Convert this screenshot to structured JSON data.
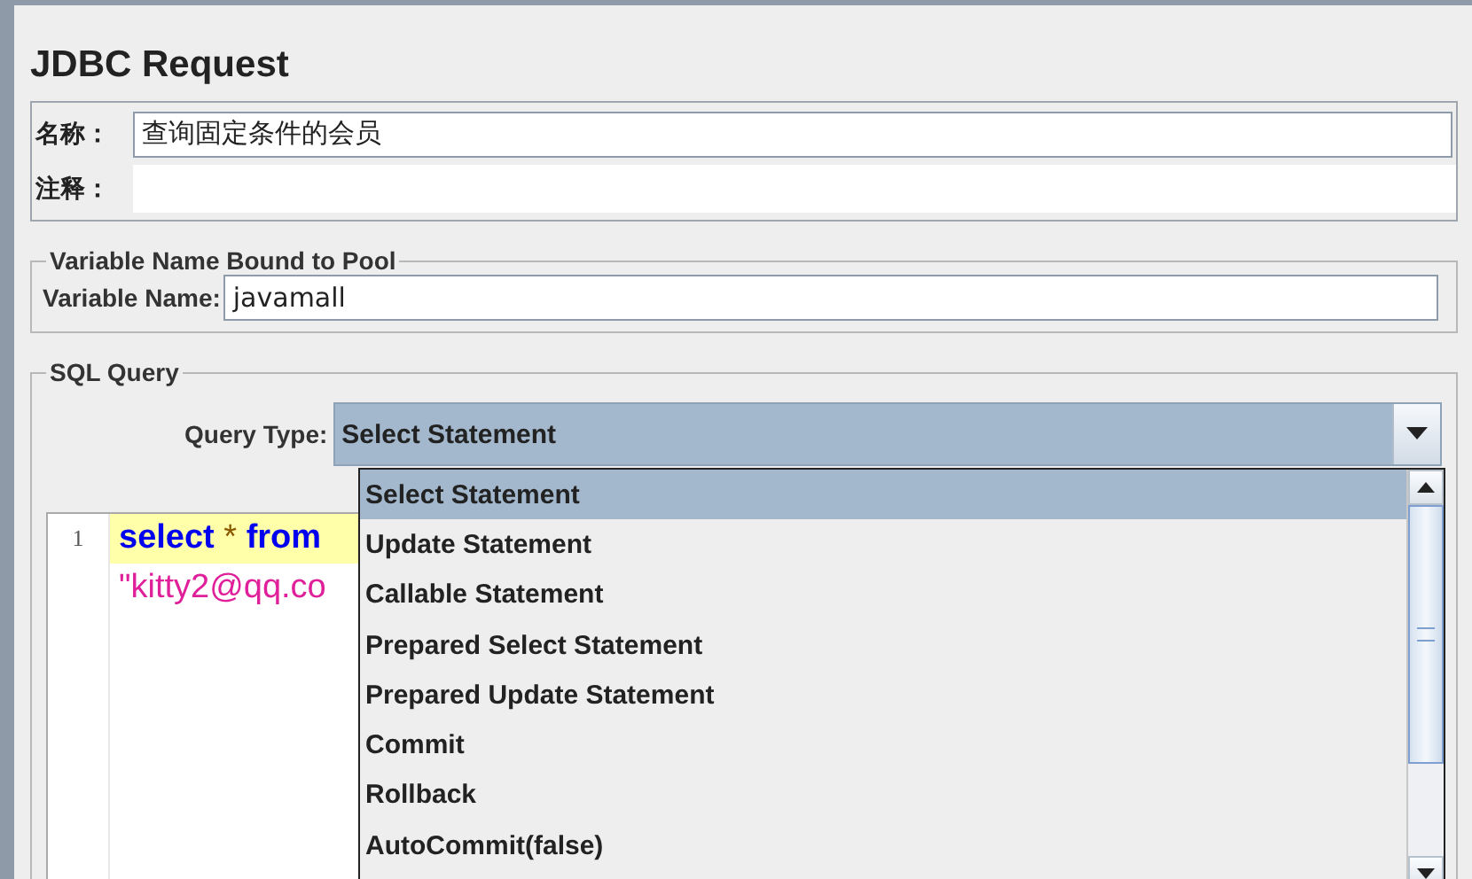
{
  "title": "JDBC Request",
  "fields": [
    {
      "label": "名称：",
      "value": "查询固定条件的会员"
    },
    {
      "label": "注释："
    }
  ],
  "pool_group": {
    "legend": "Variable Name Bound to Pool",
    "label": "Variable Name:",
    "value": "javamall"
  },
  "sql_group": {
    "legend": "SQL Query",
    "query_type_label": "Query Type:",
    "query_type_value": "Select Statement",
    "options": [
      {
        "label": "Select Statement",
        "selected": true
      },
      {
        "label": "Update Statement",
        "selected": false
      },
      {
        "label": "Callable Statement",
        "selected": false
      },
      {
        "label": "Prepared Select Statement",
        "selected": false
      },
      {
        "label": "Prepared Update Statement",
        "selected": false
      },
      {
        "label": "Commit",
        "selected": false
      },
      {
        "label": "Rollback",
        "selected": false
      },
      {
        "label": "AutoCommit(false)",
        "selected": false
      }
    ],
    "editor_lines": [
      {
        "number": "1",
        "highlighted": true,
        "tokens": [
          {
            "kind": "keyword",
            "text": "select"
          },
          {
            "kind": "operator",
            "text": " * "
          },
          {
            "kind": "keyword",
            "text": "from"
          }
        ]
      },
      {
        "highlighted": false,
        "tokens": [
          {
            "kind": "string",
            "text": "\"kitty2@qq.co"
          }
        ]
      }
    ]
  }
}
